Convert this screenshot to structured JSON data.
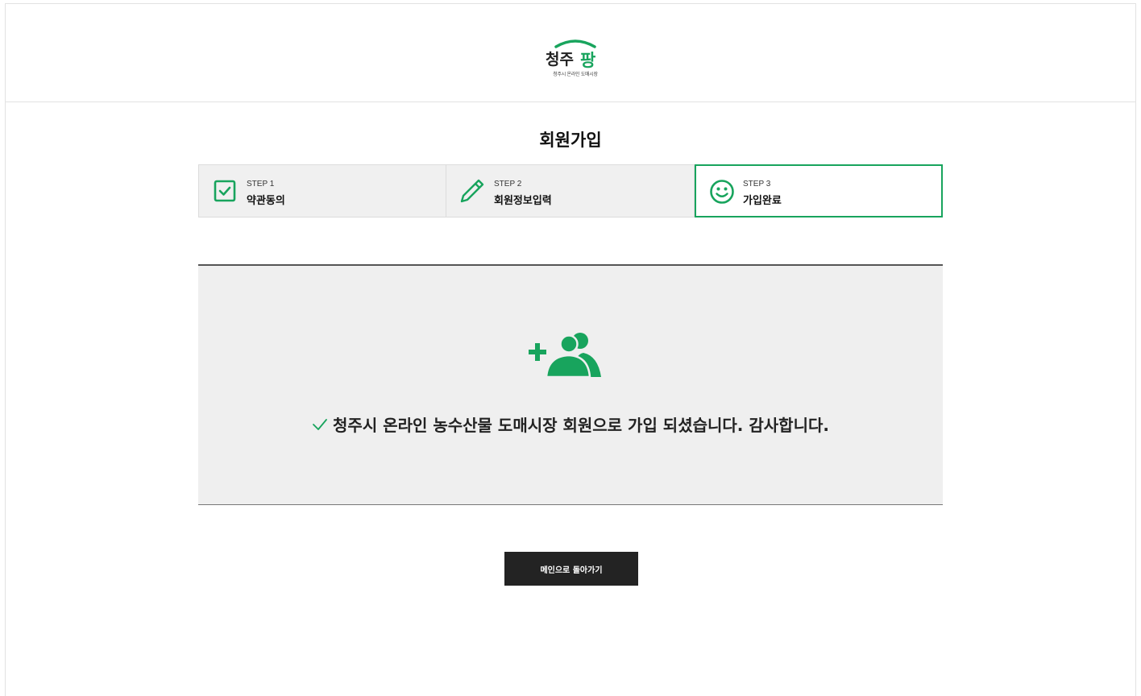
{
  "brand": {
    "name": "청주팡",
    "tagline": "청주시 온라인 도매시장",
    "accent_color": "#18a45d"
  },
  "page": {
    "title": "회원가입"
  },
  "steps": [
    {
      "num": "STEP 1",
      "label": "약관동의",
      "icon": "checkbox-icon",
      "active": false
    },
    {
      "num": "STEP 2",
      "label": "회원정보입력",
      "icon": "pencil-icon",
      "active": false
    },
    {
      "num": "STEP 3",
      "label": "가입완료",
      "icon": "smile-icon",
      "active": true
    }
  ],
  "completion": {
    "icon": "user-add-icon",
    "check_icon": "check-icon",
    "message": "청주시 온라인 농수산물 도매시장 회원으로 가입 되셨습니다. 감사합니다."
  },
  "actions": {
    "main_button_label": "메인으로 돌아가기"
  }
}
